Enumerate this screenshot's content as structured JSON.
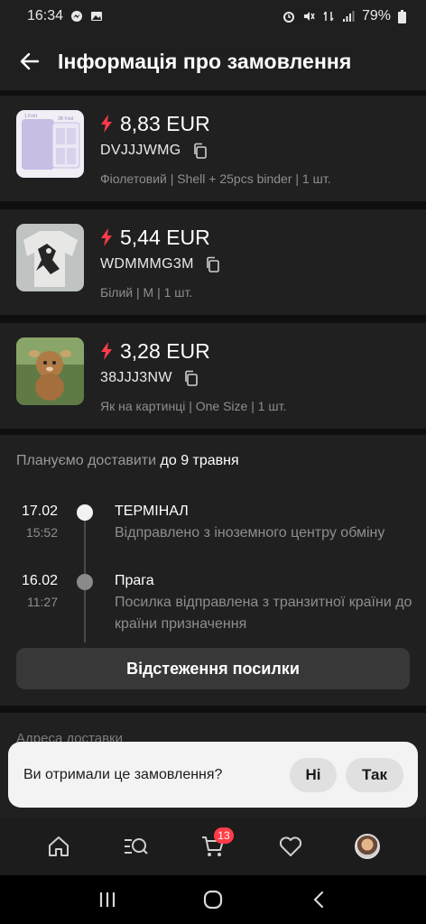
{
  "status_bar": {
    "time": "16:34",
    "battery": "79%"
  },
  "header": {
    "title": "Інформація про замовлення"
  },
  "products": [
    {
      "price": "8,83 EUR",
      "code": "DVJJJWMG",
      "variant": "Фіолетовий | Shell + 25pcs binder | 1 шт.",
      "thumb_labels": [
        "1 Fold",
        "3B Fold"
      ]
    },
    {
      "price": "5,44 EUR",
      "code": "WDMMMG3M",
      "variant": "Білий | M | 1 шт."
    },
    {
      "price": "3,28 EUR",
      "code": "38JJJ3NW",
      "variant": "Як на картинці | One Size | 1 шт."
    }
  ],
  "delivery": {
    "plan_prefix": "Плануємо доставити",
    "plan_date": "до 9 травня",
    "events": [
      {
        "date": "17.02",
        "time": "15:52",
        "title": "ТЕРМІНАЛ",
        "description": "Відправлено з іноземного центру обміну",
        "active": true
      },
      {
        "date": "16.02",
        "time": "11:27",
        "title": "Прага",
        "description": "Посилка відправлена з транзитної країни до країни призначення",
        "active": false
      }
    ],
    "track_button": "Відстеження посилки"
  },
  "address": {
    "label": "Адреса доставки"
  },
  "prompt": {
    "question": "Ви отримали це замовлення?",
    "no": "Ні",
    "yes": "Так"
  },
  "nav": {
    "cart_count": "13",
    "items": [
      "home-icon",
      "search-list-icon",
      "cart-icon",
      "heart-icon",
      "profile-avatar"
    ]
  },
  "colors": {
    "accent": "#ff3b48",
    "bolt": "#ff3b48",
    "background": "#0f0f0f",
    "card": "#202020"
  }
}
